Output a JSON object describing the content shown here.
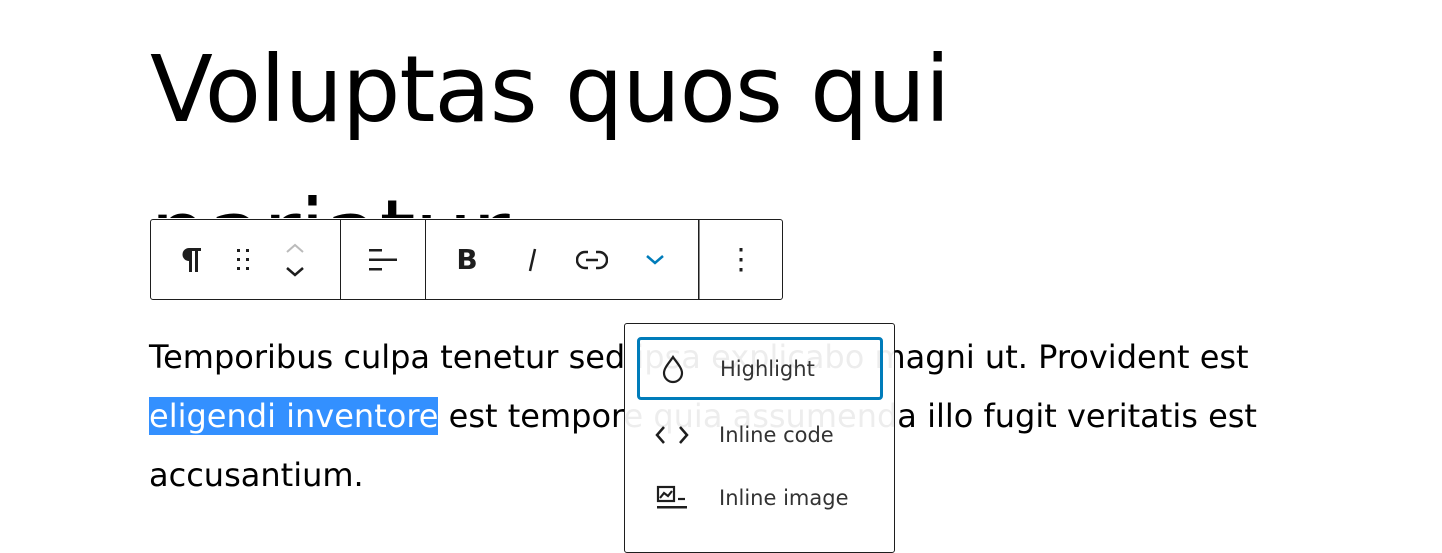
{
  "post": {
    "title": "Voluptas quos qui pariatur",
    "paragraph": {
      "before": "Temporibus culpa tenetur sed ipsa explicabo magni ut. Provident est ",
      "selected": "eligendi inventore",
      "after": " est tempore quia assumenda illo fugit veritatis est accusantium."
    }
  },
  "toolbar": {
    "groups": [
      {
        "items": [
          {
            "name": "paragraph",
            "label": "Paragraph"
          },
          {
            "name": "drag",
            "label": "Drag"
          },
          {
            "name": "move",
            "label": "Move up / Move down"
          }
        ]
      },
      {
        "items": [
          {
            "name": "align",
            "label": "Align text"
          }
        ]
      },
      {
        "items": [
          {
            "name": "bold",
            "label": "Bold"
          },
          {
            "name": "italic",
            "label": "Italic"
          },
          {
            "name": "link",
            "label": "Link"
          },
          {
            "name": "more-rich-text",
            "label": "More"
          }
        ]
      },
      {
        "items": [
          {
            "name": "options",
            "label": "Options"
          }
        ]
      }
    ],
    "accent": "#007cba"
  },
  "dropdown": {
    "items": [
      {
        "label": "Highlight",
        "icon": "droplet-icon",
        "focused": true
      },
      {
        "label": "Inline code",
        "icon": "code-icon",
        "focused": false
      },
      {
        "label": "Inline image",
        "icon": "image-icon",
        "focused": false
      }
    ]
  },
  "colors": {
    "selection": "#3390ff",
    "focus": "#007cba"
  }
}
